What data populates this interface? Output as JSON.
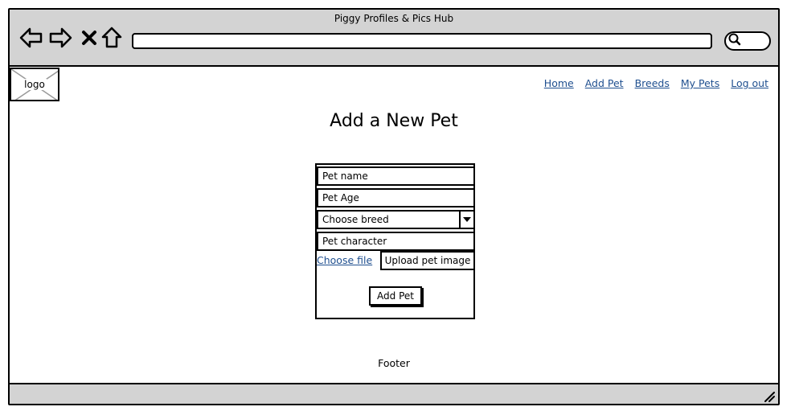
{
  "window": {
    "title": "Piggy Profiles & Pics Hub"
  },
  "toolbar": {
    "icons": [
      "back-arrow-icon",
      "forward-arrow-icon",
      "close-icon",
      "home-icon",
      "search-icon"
    ],
    "address": ""
  },
  "logo": {
    "label": "logo"
  },
  "nav": {
    "items": [
      {
        "label": "Home"
      },
      {
        "label": "Add Pet"
      },
      {
        "label": "Breeds"
      },
      {
        "label": "My Pets"
      },
      {
        "label": "Log out"
      }
    ]
  },
  "page": {
    "title": "Add a New Pet"
  },
  "form": {
    "pet_name_placeholder": "Pet name",
    "pet_age_placeholder": "Pet Age",
    "breed_selected": "Choose breed",
    "pet_character_placeholder": "Pet character",
    "choose_file_label": "Choose file",
    "upload_label": "Upload pet image",
    "submit_label": "Add Pet"
  },
  "footer": {
    "text": "Footer"
  },
  "colors": {
    "chrome": "#d3d3d3",
    "link": "#1f4f8f",
    "border": "#000000"
  }
}
